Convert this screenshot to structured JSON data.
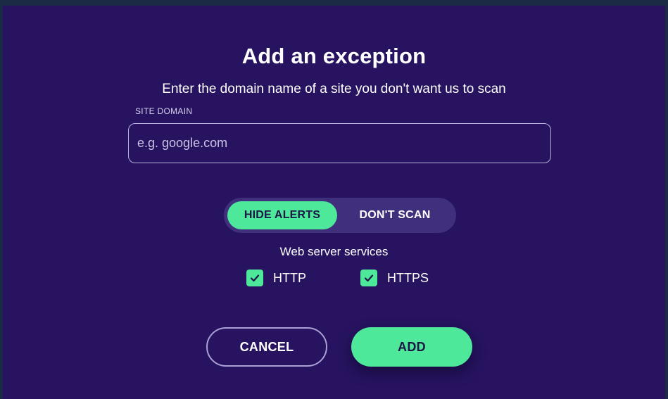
{
  "dialog": {
    "title": "Add an exception",
    "subtitle": "Enter the domain name of a site you don't want us to scan",
    "domain_field": {
      "label": "SITE DOMAIN",
      "placeholder": "e.g. google.com",
      "value": ""
    },
    "mode_toggle": {
      "options": [
        "HIDE ALERTS",
        "DON'T SCAN"
      ],
      "selected": "HIDE ALERTS"
    },
    "services": {
      "label": "Web server services",
      "items": [
        {
          "label": "HTTP",
          "checked": true
        },
        {
          "label": "HTTPS",
          "checked": true
        }
      ]
    },
    "buttons": {
      "cancel_label": "CANCEL",
      "add_label": "ADD"
    }
  },
  "colors": {
    "background": "#27135f",
    "accent": "#4ee89a",
    "outer": "#1b2a45"
  },
  "icons": {
    "checkbox": "check-icon"
  }
}
